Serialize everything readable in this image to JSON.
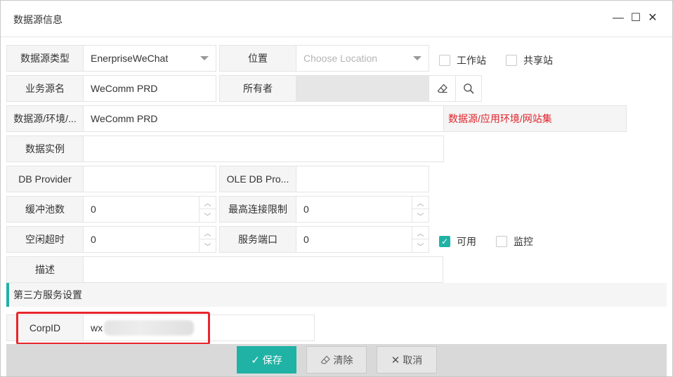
{
  "window": {
    "title": "数据源信息",
    "minimize_glyph": "—",
    "maximize_glyph": "☐",
    "close_glyph": "✕"
  },
  "form": {
    "type_label": "数据源类型",
    "type_value": "EnerpriseWeChat",
    "location_label": "位置",
    "location_placeholder": "Choose Location",
    "workstation_label": "工作站",
    "shared_label": "共享站",
    "business_name_label": "业务源名",
    "business_name_value": "WeComm PRD",
    "owner_label": "所有者",
    "env_label": "数据源/环境/...",
    "env_value": "WeComm PRD",
    "env_hint": "数据源/应用环境/网站集",
    "instance_label": "数据实例",
    "instance_value": "",
    "db_provider_label": "DB Provider",
    "db_provider_value": "",
    "ole_provider_label": "OLE DB Pro...",
    "ole_provider_value": "",
    "pool_label": "缓冲池数",
    "pool_value": "0",
    "max_conn_label": "最高连接限制",
    "max_conn_value": "0",
    "idle_label": "空闲超时",
    "idle_value": "0",
    "port_label": "服务端口",
    "port_value": "0",
    "enabled_label": "可用",
    "monitor_label": "监控",
    "desc_label": "描述",
    "desc_value": ""
  },
  "third_party": {
    "section_title": "第三方服务设置",
    "corpid_label": "CorpID",
    "corpid_value": "wx"
  },
  "footer": {
    "save_label": "保存",
    "clear_label": "清除",
    "cancel_label": "取消"
  },
  "colors": {
    "accent": "#20b2a5",
    "hint_red": "#e0232b",
    "highlight_red": "#e8262b"
  }
}
